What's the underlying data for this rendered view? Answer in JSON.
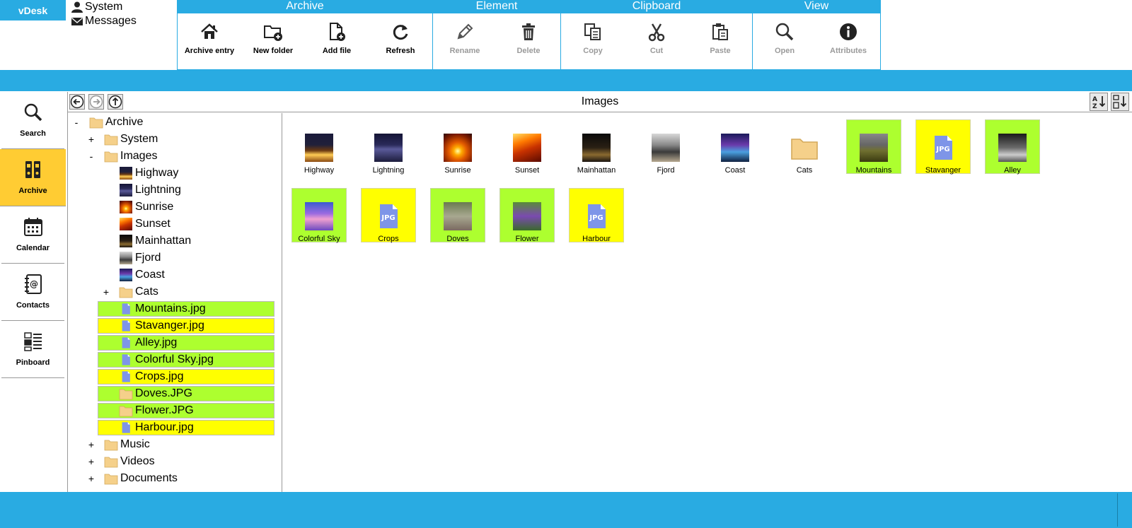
{
  "app": {
    "name": "vDesk"
  },
  "top_links": [
    {
      "label": "System",
      "icon": "user-icon"
    },
    {
      "label": "Messages",
      "icon": "envelope-icon"
    }
  ],
  "ribbon": {
    "groups": [
      {
        "title": "Archive",
        "buttons": [
          {
            "label": "Archive entry",
            "icon": "home-icon",
            "enabled": true
          },
          {
            "label": "New folder",
            "icon": "folder-plus-icon",
            "enabled": true
          },
          {
            "label": "Add file",
            "icon": "file-plus-icon",
            "enabled": true
          },
          {
            "label": "Refresh",
            "icon": "refresh-icon",
            "enabled": true
          }
        ]
      },
      {
        "title": "Element",
        "buttons": [
          {
            "label": "Rename",
            "icon": "pencil-icon",
            "enabled": false
          },
          {
            "label": "Delete",
            "icon": "trash-icon",
            "enabled": false
          }
        ]
      },
      {
        "title": "Clipboard",
        "buttons": [
          {
            "label": "Copy",
            "icon": "copy-icon",
            "enabled": false
          },
          {
            "label": "Cut",
            "icon": "scissors-icon",
            "enabled": false
          },
          {
            "label": "Paste",
            "icon": "paste-icon",
            "enabled": false
          }
        ]
      },
      {
        "title": "View",
        "buttons": [
          {
            "label": "Open",
            "icon": "magnifier-icon",
            "enabled": false
          },
          {
            "label": "Attributes",
            "icon": "info-icon",
            "enabled": false
          }
        ]
      }
    ]
  },
  "side_nav": [
    {
      "label": "Search",
      "icon": "search-icon",
      "active": false
    },
    {
      "label": "Archive",
      "icon": "binders-icon",
      "active": true
    },
    {
      "label": "Calendar",
      "icon": "calendar-icon",
      "active": false
    },
    {
      "label": "Contacts",
      "icon": "address-book-icon",
      "active": false
    },
    {
      "label": "Pinboard",
      "icon": "pinboard-icon",
      "active": false
    }
  ],
  "browser": {
    "current_folder": "Images",
    "tree": [
      {
        "label": "Archive",
        "level": 0,
        "toggle": "-",
        "icon": "folder"
      },
      {
        "label": "System",
        "level": 1,
        "toggle": "+",
        "icon": "folder"
      },
      {
        "label": "Images",
        "level": 1,
        "toggle": "-",
        "icon": "folder"
      },
      {
        "label": "Highway",
        "level": 2,
        "toggle": "",
        "icon": "thumb",
        "thumb": "highway"
      },
      {
        "label": "Lightning",
        "level": 2,
        "toggle": "",
        "icon": "thumb",
        "thumb": "lightning"
      },
      {
        "label": "Sunrise",
        "level": 2,
        "toggle": "",
        "icon": "thumb",
        "thumb": "sunrise"
      },
      {
        "label": "Sunset",
        "level": 2,
        "toggle": "",
        "icon": "thumb",
        "thumb": "sunset"
      },
      {
        "label": "Mainhattan",
        "level": 2,
        "toggle": "",
        "icon": "thumb",
        "thumb": "mainhattan"
      },
      {
        "label": "Fjord",
        "level": 2,
        "toggle": "",
        "icon": "thumb",
        "thumb": "fjord"
      },
      {
        "label": "Coast",
        "level": 2,
        "toggle": "",
        "icon": "thumb",
        "thumb": "coast"
      },
      {
        "label": "Cats",
        "level": 2,
        "toggle": "+",
        "icon": "folder"
      },
      {
        "label": "Mountains.jpg",
        "level": 2,
        "toggle": "",
        "icon": "jpg",
        "highlight": "green"
      },
      {
        "label": "Stavanger.jpg",
        "level": 2,
        "toggle": "",
        "icon": "jpg",
        "highlight": "yellow"
      },
      {
        "label": "Alley.jpg",
        "level": 2,
        "toggle": "",
        "icon": "jpg",
        "highlight": "green"
      },
      {
        "label": "Colorful Sky.jpg",
        "level": 2,
        "toggle": "",
        "icon": "jpg",
        "highlight": "green"
      },
      {
        "label": "Crops.jpg",
        "level": 2,
        "toggle": "",
        "icon": "jpg",
        "highlight": "yellow"
      },
      {
        "label": "Doves.JPG",
        "level": 2,
        "toggle": "",
        "icon": "folder",
        "highlight": "green"
      },
      {
        "label": "Flower.JPG",
        "level": 2,
        "toggle": "",
        "icon": "folder",
        "highlight": "green"
      },
      {
        "label": "Harbour.jpg",
        "level": 2,
        "toggle": "",
        "icon": "jpg",
        "highlight": "yellow"
      },
      {
        "label": "Music",
        "level": 1,
        "toggle": "+",
        "icon": "folder"
      },
      {
        "label": "Videos",
        "level": 1,
        "toggle": "+",
        "icon": "folder"
      },
      {
        "label": "Documents",
        "level": 1,
        "toggle": "+",
        "icon": "folder"
      }
    ],
    "grid": [
      {
        "label": "Highway",
        "icon": "thumb",
        "thumb": "highway",
        "highlight": ""
      },
      {
        "label": "Lightning",
        "icon": "thumb",
        "thumb": "lightning",
        "highlight": ""
      },
      {
        "label": "Sunrise",
        "icon": "thumb",
        "thumb": "sunrise",
        "highlight": ""
      },
      {
        "label": "Sunset",
        "icon": "thumb",
        "thumb": "sunset",
        "highlight": ""
      },
      {
        "label": "Mainhattan",
        "icon": "thumb",
        "thumb": "mainhattan",
        "highlight": ""
      },
      {
        "label": "Fjord",
        "icon": "thumb",
        "thumb": "fjord",
        "highlight": ""
      },
      {
        "label": "Coast",
        "icon": "thumb",
        "thumb": "coast",
        "highlight": ""
      },
      {
        "label": "Cats",
        "icon": "folder",
        "highlight": ""
      },
      {
        "label": "Mountains",
        "icon": "thumb",
        "thumb": "mountains",
        "highlight": "green"
      },
      {
        "label": "Stavanger",
        "icon": "jpg",
        "highlight": "yellow"
      },
      {
        "label": "Alley",
        "icon": "thumb",
        "thumb": "alley",
        "highlight": "green"
      },
      {
        "label": "Colorful Sky",
        "icon": "thumb",
        "thumb": "colorful",
        "highlight": "green"
      },
      {
        "label": "Crops",
        "icon": "jpg",
        "highlight": "yellow"
      },
      {
        "label": "Doves",
        "icon": "thumb",
        "thumb": "doves",
        "highlight": "green"
      },
      {
        "label": "Flower",
        "icon": "thumb",
        "thumb": "flower",
        "highlight": "green"
      },
      {
        "label": "Harbour",
        "icon": "jpg",
        "highlight": "yellow"
      }
    ],
    "jpg_badge": "JPG"
  },
  "colors": {
    "accent": "#29ABE2",
    "active_nav": "#FFCC33",
    "highlight_green": "#ADFF2F",
    "highlight_yellow": "#FFFF00",
    "folder": "#F5D08A"
  }
}
